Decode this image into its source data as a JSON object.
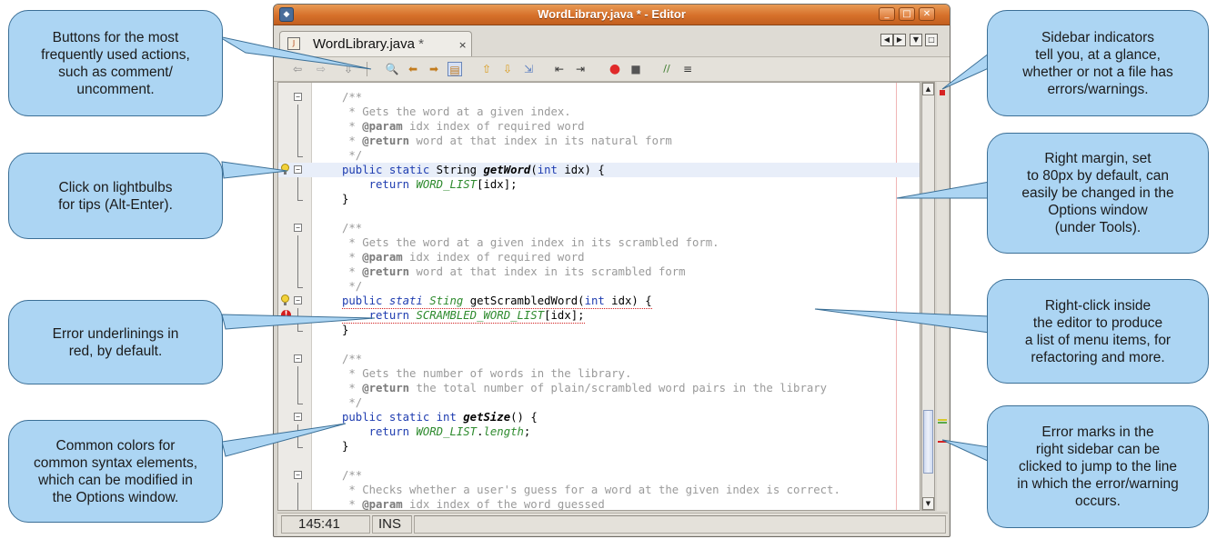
{
  "window": {
    "title": "WordLibrary.java * - Editor",
    "tab_name": "WordLibrary.java",
    "tab_modified": "*",
    "tab_close": "×"
  },
  "toolbar": {
    "icons": [
      "back-icon",
      "forward-icon",
      "history-icon",
      "find-icon",
      "find-previous-icon",
      "find-next-icon",
      "toggle-highlight-icon",
      "previous-bookmark-icon",
      "next-bookmark-icon",
      "toggle-bookmark-icon",
      "shift-left-icon",
      "shift-right-icon",
      "start-macro-icon",
      "stop-macro-icon",
      "comment-icon",
      "uncomment-icon"
    ]
  },
  "code": {
    "lines": [
      [
        "/**"
      ],
      [
        " * Gets the word at a given index."
      ],
      [
        " * @param idx index of required word"
      ],
      [
        " * @return word at that index in its natural form"
      ],
      [
        " */"
      ],
      [
        "public static String getWord(int idx) {"
      ],
      [
        "    return WORD_LIST[idx];"
      ],
      [
        "}"
      ],
      [
        ""
      ],
      [
        "/**"
      ],
      [
        " * Gets the word at a given index in its scrambled form."
      ],
      [
        " * @param idx index of required word"
      ],
      [
        " * @return word at that index in its scrambled form"
      ],
      [
        " */"
      ],
      [
        "public stati Sting getScrambledWord(int idx) {"
      ],
      [
        "    return SCRAMBLED_WORD_LIST[idx];"
      ],
      [
        "}"
      ],
      [
        ""
      ],
      [
        "/**"
      ],
      [
        " * Gets the number of words in the library."
      ],
      [
        " * @return the total number of plain/scrambled word pairs in the library"
      ],
      [
        " */"
      ],
      [
        "public static int getSize() {"
      ],
      [
        "    return WORD_LIST.length;"
      ],
      [
        "}"
      ],
      [
        ""
      ],
      [
        "/**"
      ],
      [
        " * Checks whether a user's guess for a word at the given index is correct."
      ],
      [
        " * @param idx index of the word guessed"
      ]
    ]
  },
  "status": {
    "position": "145:41",
    "mode": "INS"
  },
  "callouts": {
    "buttons": [
      "Buttons for the most",
      "frequently used actions,",
      "such as comment/",
      "uncomment."
    ],
    "lightbulbs": [
      "Click on lightbulbs",
      "for tips (Alt-Enter)."
    ],
    "errors": [
      "Error underlinings in",
      "red, by default."
    ],
    "colors": [
      "Common colors for",
      "common syntax elements,",
      "which can be modified in",
      "the Options window."
    ],
    "sidebar": [
      "Sidebar indicators",
      "tell you, at a glance,",
      "whether or not a file has",
      "errors/warnings."
    ],
    "margin": [
      "Right margin, set",
      "to 80px by default, can",
      "easily be changed in the",
      "Options window",
      "(under Tools)."
    ],
    "rightclick": [
      "Right-click inside",
      "the editor to produce",
      "a list of menu items, for",
      "refactoring and more."
    ],
    "errormarks": [
      "Error marks in the",
      "right sidebar can be",
      "clicked to jump to the line",
      "in which the error/warning",
      "occurs."
    ]
  }
}
